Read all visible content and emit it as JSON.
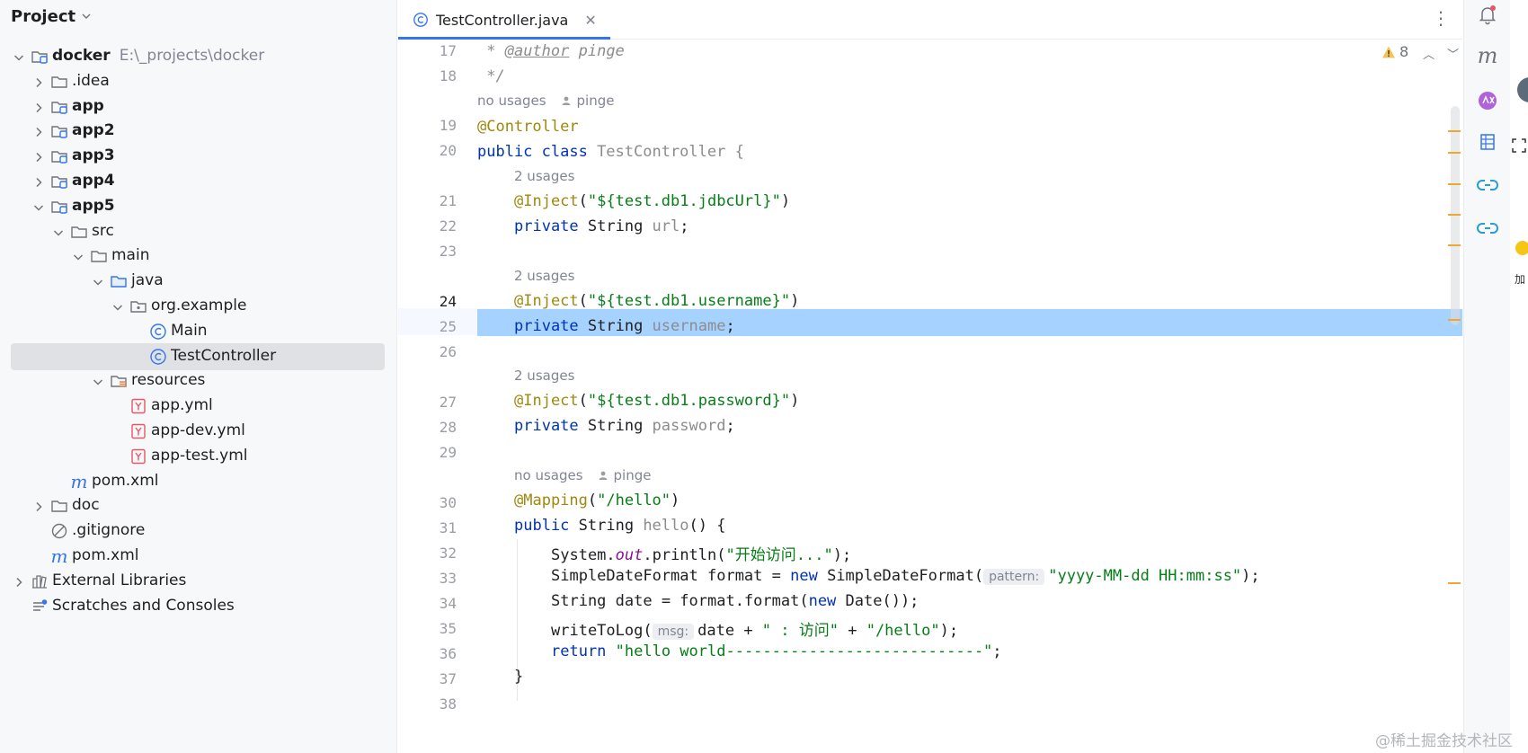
{
  "project_panel": {
    "title": "Project",
    "tree": [
      {
        "label": "docker",
        "path": "E:\\_projects\\docker",
        "depth": 0,
        "state": "expanded",
        "icon": "module-folder-icon",
        "bold": true
      },
      {
        "label": ".idea",
        "depth": 1,
        "state": "collapsed",
        "icon": "folder-icon"
      },
      {
        "label": "app",
        "depth": 1,
        "state": "collapsed",
        "icon": "module-folder-icon",
        "bold": true
      },
      {
        "label": "app2",
        "depth": 1,
        "state": "collapsed",
        "icon": "module-folder-icon",
        "bold": true
      },
      {
        "label": "app3",
        "depth": 1,
        "state": "collapsed",
        "icon": "module-folder-icon",
        "bold": true
      },
      {
        "label": "app4",
        "depth": 1,
        "state": "collapsed",
        "icon": "module-folder-icon",
        "bold": true
      },
      {
        "label": "app5",
        "depth": 1,
        "state": "expanded",
        "icon": "module-folder-icon",
        "bold": true
      },
      {
        "label": "src",
        "depth": 2,
        "state": "expanded",
        "icon": "folder-icon"
      },
      {
        "label": "main",
        "depth": 3,
        "state": "expanded",
        "icon": "folder-icon"
      },
      {
        "label": "java",
        "depth": 4,
        "state": "expanded",
        "icon": "source-folder-icon"
      },
      {
        "label": "org.example",
        "depth": 5,
        "state": "expanded",
        "icon": "package-icon"
      },
      {
        "label": "Main",
        "depth": 6,
        "state": "leaf",
        "icon": "java-class-icon"
      },
      {
        "label": "TestController",
        "depth": 6,
        "state": "leaf",
        "icon": "java-class-icon",
        "selected": true
      },
      {
        "label": "resources",
        "depth": 4,
        "state": "expanded",
        "icon": "resources-folder-icon"
      },
      {
        "label": "app.yml",
        "depth": 5,
        "state": "leaf",
        "icon": "yaml-file-icon"
      },
      {
        "label": "app-dev.yml",
        "depth": 5,
        "state": "leaf",
        "icon": "yaml-file-icon"
      },
      {
        "label": "app-test.yml",
        "depth": 5,
        "state": "leaf",
        "icon": "yaml-file-icon"
      },
      {
        "label": "pom.xml",
        "depth": 2,
        "state": "leaf",
        "icon": "maven-icon"
      },
      {
        "label": "doc",
        "depth": 1,
        "state": "collapsed",
        "icon": "folder-icon"
      },
      {
        "label": ".gitignore",
        "depth": 1,
        "state": "leaf",
        "icon": "ignore-file-icon"
      },
      {
        "label": "pom.xml",
        "depth": 1,
        "state": "leaf",
        "icon": "maven-icon"
      },
      {
        "label": "External Libraries",
        "depth": 0,
        "state": "collapsed",
        "icon": "library-icon"
      },
      {
        "label": "Scratches and Consoles",
        "depth": 0,
        "state": "leaf",
        "icon": "scratches-icon"
      }
    ]
  },
  "editor": {
    "tab_label": "TestController.java",
    "warning_count": "8",
    "current_line": "24",
    "line_numbers": [
      "17",
      "18",
      "19",
      "20",
      "21",
      "22",
      "23",
      "24",
      "25",
      "26",
      "27",
      "28",
      "29",
      "30",
      "31",
      "32",
      "33",
      "34",
      "35",
      "36",
      "37",
      "38"
    ],
    "hints": {
      "no_usages": "no usages",
      "two_usages": "2 usages",
      "author": "pinge",
      "param_pattern": "pattern:",
      "param_msg": "msg:"
    },
    "code": {
      "l17_star": " * ",
      "l17_tag": "@author",
      "l17_rest": " pinge",
      "l18": " */",
      "l19": "@Controller",
      "l20_kw": "public class ",
      "l20_rest": "TestController {",
      "l21_ann": "@Inject",
      "l21_str": "\"${test.db1.jdbcUrl}\"",
      "l22_kw": "private ",
      "l22_type": "String ",
      "l22_field": "url",
      "l24_ann": "@Inject",
      "l24_str": "\"${test.db1.username}\"",
      "l25_field": "username",
      "l27_ann": "@Inject",
      "l27_str": "\"${test.db1.password}\"",
      "l28_field": "password",
      "l30_ann": "@Mapping",
      "l30_str": "\"/hello\"",
      "l31_kw": "public ",
      "l31_type": "String ",
      "l31_method": "hello",
      "l31_rest": "() {",
      "l32_a": "System.",
      "l32_out": "out",
      "l32_b": ".println(",
      "l32_str": "\"开始访问...\"",
      "l32_c": ");",
      "l33_a": "SimpleDateFormat format = ",
      "l33_new": "new ",
      "l33_b": "SimpleDateFormat(",
      "l33_str": "\"yyyy-MM-dd HH:mm:ss\"",
      "l33_c": ");",
      "l34_a": "String date = format.format(",
      "l34_new": "new ",
      "l34_b": "Date());",
      "l35_a": "writeToLog(",
      "l35_b": "date + ",
      "l35_str1": "\" : 访问\"",
      "l35_c": " + ",
      "l35_str2": "\"/hello\"",
      "l35_d": ");",
      "l36_kw": "return ",
      "l36_str": "\"hello world----------------------------\"",
      "l36_c": ";",
      "l37": "}"
    }
  },
  "right_toolbar": [
    "notifications-icon",
    "maven-icon",
    "ai-assistant-icon",
    "database-icon",
    "link-icon",
    "link-icon"
  ],
  "edge_text": "加",
  "watermark": "@稀土掘金技术社区",
  "colors": {
    "accent": "#3574f0",
    "selection": "#a6d2ff",
    "keyword": "#0033b3",
    "string": "#067d17",
    "annotation": "#9e880d"
  }
}
